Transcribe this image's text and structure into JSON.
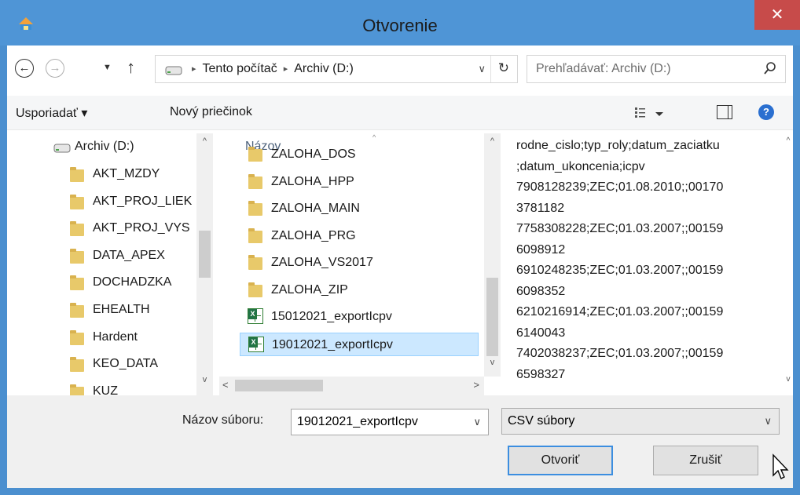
{
  "window": {
    "title": "Otvorenie",
    "close_glyph": "✕"
  },
  "nav": {
    "back_glyph": "←",
    "forward_glyph": "→",
    "recent_glyph": "▼",
    "up_glyph": "↑"
  },
  "address": {
    "crumbs": [
      "Tento počítač",
      "Archiv (D:)"
    ],
    "separator": "▸",
    "dropdown_glyph": "∨",
    "refresh_glyph": "↻"
  },
  "search": {
    "placeholder": "Prehľadávať: Archiv (D:)"
  },
  "commandbar": {
    "organize_label": "Usporiadať ▾",
    "new_folder_label": "Nový priečinok",
    "help_glyph": "?"
  },
  "tree": {
    "drive_label": "Archiv (D:)",
    "folders": [
      "AKT_MZDY",
      "AKT_PROJ_LIEK",
      "AKT_PROJ_VYS",
      "DATA_APEX",
      "DOCHADZKA",
      "EHEALTH",
      "Hardent",
      "KEO_DATA",
      "KUZ"
    ]
  },
  "files": {
    "column_name": "Názov",
    "sort_glyph": "^",
    "folders": [
      "ZALOHA_DOS",
      "ZALOHA_HPP",
      "ZALOHA_MAIN",
      "ZALOHA_PRG",
      "ZALOHA_VS2017",
      "ZALOHA_ZIP"
    ],
    "csv_files": [
      "15012021_exportIcpv",
      "19012021_exportIcpv"
    ],
    "selected": "19012021_exportIcpv"
  },
  "preview": {
    "lines": [
      "rodne_cislo;typ_roly;datum_zaciatku",
      ";datum_ukoncenia;icpv",
      "7908128239;ZEC;01.08.2010;;00170",
      "3781182",
      "7758308228;ZEC;01.03.2007;;00159",
      "6098912",
      "6910248235;ZEC;01.03.2007;;00159",
      "6098352",
      "6210216914;ZEC;01.03.2007;;00159",
      "6140043",
      "7402038237;ZEC;01.03.2007;;00159",
      "6598327"
    ]
  },
  "bottom": {
    "filename_label": "Názov súboru:",
    "filename_value": "19012021_exportIcpv",
    "filetype_value": "CSV súbory",
    "dropdown_glyph": "∨",
    "open_label": "Otvoriť",
    "cancel_label": "Zrušiť"
  },
  "colors": {
    "titlebar": "#4f95d6",
    "close": "#c74b4a",
    "selection": "#cce8ff",
    "folder": "#e8c96a"
  }
}
